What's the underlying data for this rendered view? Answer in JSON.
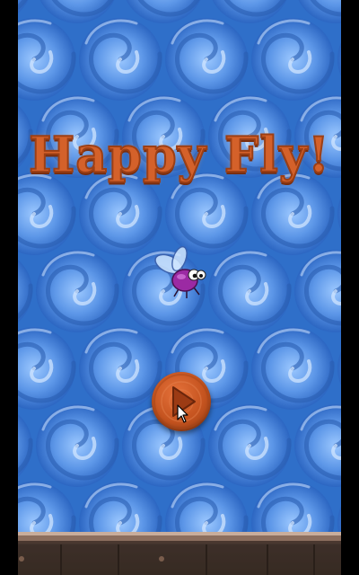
{
  "game": {
    "title": "Happy Fly!"
  },
  "menu": {
    "play_icon": "play-icon"
  },
  "colors": {
    "background_blue": "#2f6fc9",
    "swirl_light": "#7fb3ff",
    "title_orange": "#d4612a",
    "button_orange": "#c4531f",
    "fly_purple": "#9b2aa3",
    "ground_brown": "#5c463c"
  }
}
